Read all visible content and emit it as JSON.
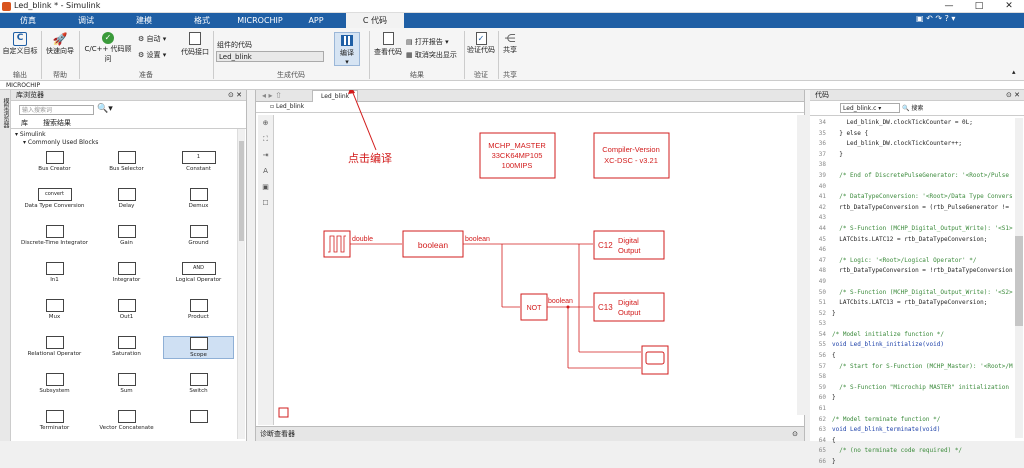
{
  "window": {
    "title": "Led_blink * - Simulink",
    "buttons": [
      "—",
      "□",
      "✕"
    ]
  },
  "tabs": [
    {
      "label": "仿真"
    },
    {
      "label": "调试"
    },
    {
      "label": "建模"
    },
    {
      "label": "格式"
    },
    {
      "label": "MICROCHIP"
    },
    {
      "label": "APP"
    },
    {
      "label": "C 代码"
    }
  ],
  "ribbon": {
    "custom_target": "自定义目标",
    "quick_start": "快速向导",
    "cpp_advisor": "C/C++ 代码顾问",
    "auto": "自动",
    "settings": "设置",
    "code_interface": "代码接口",
    "component_code_label": "组件的代码",
    "component_code_value": "Led_blink",
    "build": "编译",
    "view_code": "查看代码",
    "open_report": "打开报告",
    "cancel_highlight": "取消突出显示",
    "verify_code": "验证代码",
    "share": "共享",
    "groups": {
      "output": "输出",
      "help": "帮助",
      "prepare": "准备",
      "generate": "生成代码",
      "results": "结果",
      "verify": "验证",
      "share": "共享"
    }
  },
  "breadcrumb": "MICROCHIP",
  "side_tabs": "模型浏览器",
  "library": {
    "title": "库浏览器",
    "search_placeholder": "输入搜索词",
    "tab_lib": "库",
    "tab_results": "搜索结果",
    "tree_root": "Simulink",
    "tree_child": "Commonly Used Blocks",
    "blocks": [
      {
        "label": "Bus Creator"
      },
      {
        "label": "Bus Selector"
      },
      {
        "label": "Constant",
        "inner": "1"
      },
      {
        "label": "Data Type Conversion",
        "inner": "convert"
      },
      {
        "label": "Delay"
      },
      {
        "label": "Demux"
      },
      {
        "label": "Discrete-Time Integrator"
      },
      {
        "label": "Gain"
      },
      {
        "label": "Ground"
      },
      {
        "label": "In1"
      },
      {
        "label": "Integrator"
      },
      {
        "label": "Logical Operator",
        "inner": "AND"
      },
      {
        "label": "Mux"
      },
      {
        "label": "Out1"
      },
      {
        "label": "Product"
      },
      {
        "label": "Relational Operator"
      },
      {
        "label": "Saturation"
      },
      {
        "label": "Scope"
      },
      {
        "label": "Subsystem"
      },
      {
        "label": "Sum"
      },
      {
        "label": "Switch"
      },
      {
        "label": "Terminator"
      },
      {
        "label": "Vector Concatenate"
      },
      {
        "label": ""
      }
    ]
  },
  "editor": {
    "tab": "Led_blink",
    "path": "Led_blink",
    "annotation": "点击编译",
    "mchp_master": [
      "MCHP_MASTER",
      "33CK64MP105",
      "100MIPS"
    ],
    "compiler": [
      "Compiler-Version",
      "XC-DSC - v3.21"
    ],
    "signal_double": "double",
    "block_boolean": "boolean",
    "signal_boolean1": "boolean",
    "signal_boolean2": "boolean",
    "block_not": "NOT",
    "out1_label": "C12",
    "out1_text": [
      "Digital",
      "Output"
    ],
    "out2_label": "C13",
    "out2_text": [
      "Digital",
      "Output"
    ],
    "diagnostics": "诊断查看器"
  },
  "code": {
    "title": "代码",
    "file": "Led_blink.c",
    "search": "搜索",
    "lines": [
      {
        "n": "34",
        "t": "    Led_blink_DW.clockTickCounter = 0L;"
      },
      {
        "n": "35",
        "t": "  } else {"
      },
      {
        "n": "36",
        "t": "    Led_blink_DW.clockTickCounter++;"
      },
      {
        "n": "37",
        "t": "  }"
      },
      {
        "n": "38",
        "t": ""
      },
      {
        "n": "39",
        "t": "  /* End of DiscretePulseGenerator: '<Root>/Pulse",
        "c": "cm"
      },
      {
        "n": "40",
        "t": ""
      },
      {
        "n": "41",
        "t": "  /* DataTypeConversion: '<Root>/Data Type Convers",
        "c": "cm"
      },
      {
        "n": "42",
        "t": "  rtb_DataTypeConversion = (rtb_PulseGenerator !="
      },
      {
        "n": "43",
        "t": ""
      },
      {
        "n": "44",
        "t": "  /* S-Function (MCHP_Digital_Output_Write): '<S1>",
        "c": "cm"
      },
      {
        "n": "45",
        "t": "  LATCbits.LATC12 = rtb_DataTypeConversion;"
      },
      {
        "n": "46",
        "t": ""
      },
      {
        "n": "47",
        "t": "  /* Logic: '<Root>/Logical Operator' */",
        "c": "cm"
      },
      {
        "n": "48",
        "t": "  rtb_DataTypeConversion = !rtb_DataTypeConversion"
      },
      {
        "n": "49",
        "t": ""
      },
      {
        "n": "50",
        "t": "  /* S-Function (MCHP_Digital_Output_Write): '<S2>",
        "c": "cm"
      },
      {
        "n": "51",
        "t": "  LATCbits.LATC13 = rtb_DataTypeConversion;"
      },
      {
        "n": "52",
        "t": "}"
      },
      {
        "n": "53",
        "t": ""
      },
      {
        "n": "54",
        "t": "/* Model initialize function */",
        "c": "cm"
      },
      {
        "n": "55",
        "t": "void Led_blink_initialize(void)",
        "c": "kw"
      },
      {
        "n": "56",
        "t": "{"
      },
      {
        "n": "57",
        "t": "  /* Start for S-Function (MCHP_Master): '<Root>/M",
        "c": "cm"
      },
      {
        "n": "58",
        "t": ""
      },
      {
        "n": "59",
        "t": "  /* S-Function \"Microchip MASTER\" initialization",
        "c": "cm"
      },
      {
        "n": "60",
        "t": "}"
      },
      {
        "n": "61",
        "t": ""
      },
      {
        "n": "62",
        "t": "/* Model terminate function */",
        "c": "cm"
      },
      {
        "n": "63",
        "t": "void Led_blink_terminate(void)",
        "c": "kw"
      },
      {
        "n": "64",
        "t": "{"
      },
      {
        "n": "65",
        "t": "  /* (no terminate code required) */",
        "c": "cm"
      },
      {
        "n": "66",
        "t": "}"
      }
    ]
  },
  "colors": {
    "accent": "#1f5fa5",
    "model_red": "#d21c1c"
  }
}
